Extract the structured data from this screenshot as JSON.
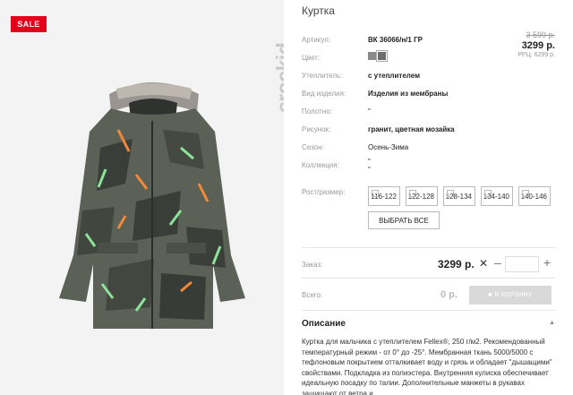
{
  "badge": {
    "sale": "SALE"
  },
  "brand": {
    "logo_text": "crockid"
  },
  "product": {
    "title": "Куртка",
    "price_old": "3 599 р.",
    "price_current": "3299 р.",
    "rrp": "РРЦ: 6299 р."
  },
  "specs": [
    {
      "label": "Артикул:",
      "value": "ВК 36066/н/1 ГР",
      "bold": true
    },
    {
      "label": "Цвет:",
      "value": ""
    },
    {
      "label": "Утеплитель:",
      "value": "с утеплителем",
      "bold": true
    },
    {
      "label": "Вид изделия:",
      "value": "Изделия из мембраны",
      "bold": true
    },
    {
      "label": "Полотно:",
      "value": "\"",
      "bold": false
    },
    {
      "label": "Рисунок:",
      "value": "гранит, цветная мозайка",
      "bold": true
    },
    {
      "label": "Сезон:",
      "value": "Осень-Зима",
      "bold": false
    },
    {
      "label": "Коллекция:",
      "value": "\"",
      "value2": "\"",
      "bold": false
    }
  ],
  "sizes": {
    "label": "Рост/размер:",
    "options": [
      "116-122",
      "122-128",
      "128-134",
      "134-140",
      "140-146"
    ],
    "select_all": "ВЫБРАТЬ ВСЕ"
  },
  "order": {
    "label": "Заказ:",
    "price": "3299 р.",
    "x": "✕",
    "minus": "–",
    "plus": "+",
    "qty": ""
  },
  "total": {
    "label": "Всего:",
    "price": "0 р.",
    "cart_button": "В КОРЗИНУ"
  },
  "description": {
    "title": "Описание",
    "text": "Куртка для мальчика с утеплителем Fellex®, 250 г/м2. Рекомендованный температурный режим - от 0° до -25°. Мембранная ткань 5000/5000 с тефлоновым покрытием отталкивает воду и грязь и обладает \"дышащими\" свойствами. Подкладка из полиэстера. Внутренняя кулиска обеспечивает идеальную посадку по талии. Дополнительные манжеты в рукавах защищают от ветра и"
  },
  "colors": {
    "sale_red": "#e3001b",
    "jacket_base": "#5b6157",
    "accent_orange": "#f08a3a",
    "accent_green": "#8ee39a"
  }
}
